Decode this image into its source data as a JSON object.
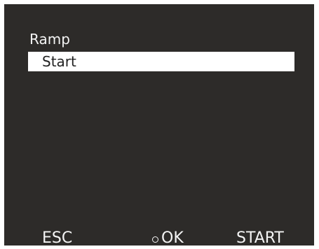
{
  "menu": {
    "title": "Ramp",
    "selected_item": "Start"
  },
  "softkeys": {
    "left_label": "ESC",
    "center_icon": "circle-icon",
    "center_label": "OK",
    "right_label": "START"
  },
  "colors": {
    "screen_background": "#2d2b29",
    "text": "#f4f4f4",
    "highlight_background": "#ffffff",
    "highlight_text": "#222222"
  }
}
